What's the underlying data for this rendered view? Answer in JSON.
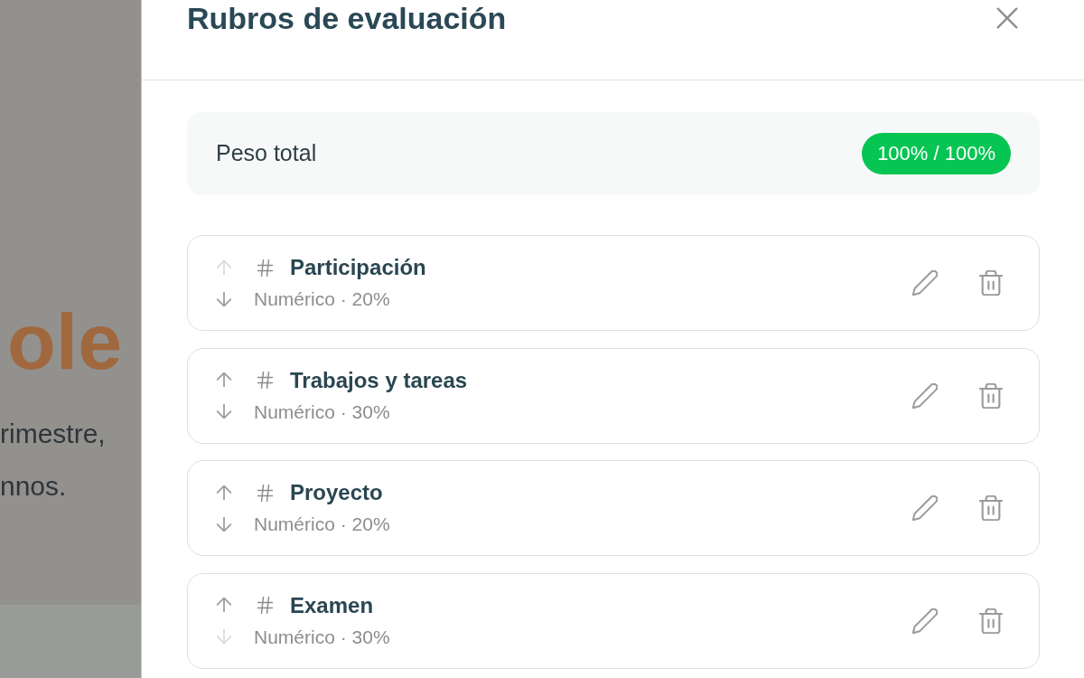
{
  "background_page": {
    "heading": "ole",
    "lines": [
      "rimestre,",
      "nnos."
    ]
  },
  "dialog": {
    "title": "Rubros de evaluación"
  },
  "total": {
    "label": "Peso total",
    "value": "100% / 100%"
  },
  "rubros": [
    {
      "name": "Participación",
      "meta": "Numérico · 20%",
      "move_up": {
        "disabled": true
      },
      "move_down": {
        "disabled": false
      }
    },
    {
      "name": "Trabajos y tareas",
      "meta": "Numérico · 30%",
      "move_up": {
        "disabled": false
      },
      "move_down": {
        "disabled": false
      }
    },
    {
      "name": "Proyecto",
      "meta": "Numérico · 20%",
      "move_up": {
        "disabled": false
      },
      "move_down": {
        "disabled": false
      }
    },
    {
      "name": "Examen",
      "meta": "Numérico · 30%",
      "move_up": {
        "disabled": false
      },
      "move_down": {
        "disabled": true
      }
    }
  ]
}
